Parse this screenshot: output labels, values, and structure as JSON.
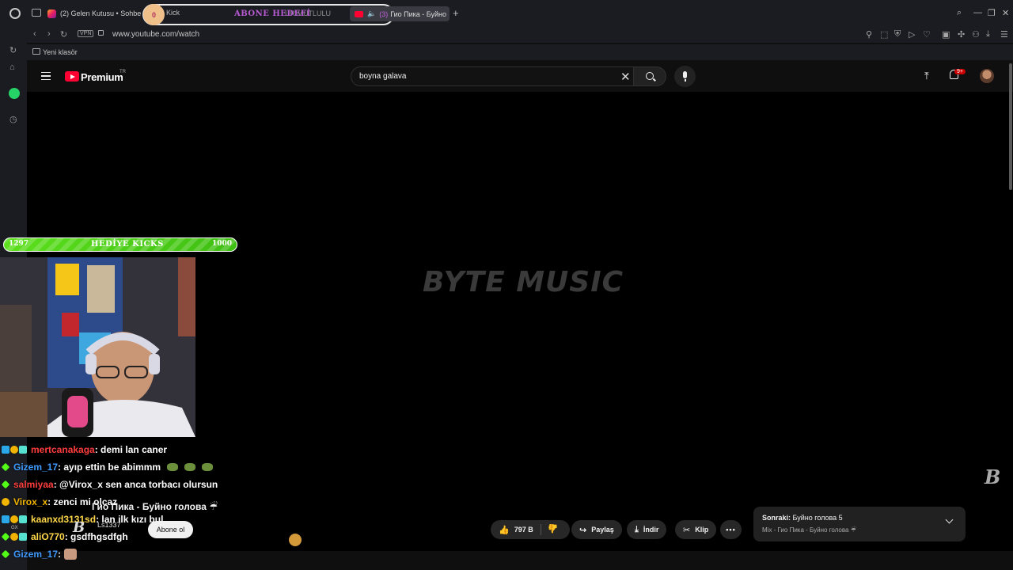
{
  "browser": {
    "tabs": [
      {
        "label": "(2) Gelen Kutusu • Sohbe"
      },
      {
        "label": "Kick"
      },
      {
        "label": "UR MUTLULU"
      },
      {
        "label": "Гио Пика - Буйно",
        "count": "(3)"
      }
    ],
    "tab_group_circle": "0",
    "overlay_text": "ABONE HEDEFİ",
    "url": "www.youtube.com/watch",
    "vpn_label": "VPN",
    "bookmark_folder": "Yeni klasör"
  },
  "youtube": {
    "logo_text": "Premium",
    "logo_region": "TR",
    "search_query": "boyna galava",
    "notification_count": "9+",
    "watermark": "BYTE MUSIC",
    "corner_mark": "B",
    "video_title": "Гио Пика - Буйно голова ☔",
    "channel_name": "Ls1337",
    "channel_mark": "B",
    "subscribe_label": "Abone ol",
    "like_count": "797 B",
    "share_label": "Paylaş",
    "download_label": "İndir",
    "clip_label": "Klip",
    "more_label": "•••",
    "next": {
      "prefix": "Sonraki:",
      "title": "Буйно голова 5",
      "subtitle": "Mix - Гио Пика - Буйно голова ☔"
    }
  },
  "stream_overlay": {
    "kicks_left": "1297",
    "kicks_title": "HEDİYE KICKS",
    "kicks_right": "1000",
    "chat": [
      {
        "user": "mertcanakaga",
        "color": "#ff3d3d",
        "msg": " : demi lan caner"
      },
      {
        "user": "Gizem_17",
        "color": "#3f9bff",
        "msg": " : ayıp ettin be abimmm"
      },
      {
        "user": "salmiyaa",
        "color": "#ff3d3d",
        "msg": " : @Virox_x sen anca torbacı olursun"
      },
      {
        "user": "Virox_x",
        "color": "#f0b400",
        "msg": " : zenci mi olcaz"
      },
      {
        "user": "kaanxd3131sd",
        "color": "#ffd84a",
        "msg": " : lan ilk kızı bul"
      },
      {
        "user": "aliO770",
        "color": "#ffd84a",
        "msg": " : gsdfhgsdfgh"
      },
      {
        "user": "Gizem_17",
        "color": "#3f9bff",
        "msg": " : "
      }
    ],
    "gx_label": "GX"
  }
}
